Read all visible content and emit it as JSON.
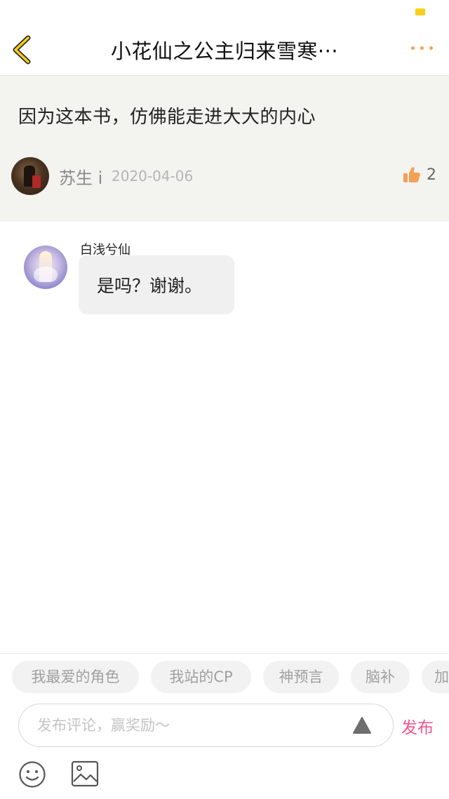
{
  "header": {
    "title": "小花仙之公主归来雪寒···"
  },
  "post": {
    "text": "因为这本书，仿佛能走进大大的内心",
    "author": "苏生 i",
    "date": "2020-04-06",
    "likes": "2"
  },
  "reply": {
    "username": "白浅兮仙",
    "text": "是吗？谢谢。"
  },
  "tags": [
    "我最爱的角色",
    "我站的CP",
    "神预言",
    "脑补",
    "加"
  ],
  "comment": {
    "placeholder": "发布评论，赢奖励～",
    "publish_label": "发布"
  },
  "colors": {
    "accent_orange": "#f3a056",
    "publish_pink": "#f0558c",
    "back_icon_yellow": "#f5cf1c",
    "card_bg": "#f3f3ef"
  },
  "icons": {
    "back": "chevron-left-icon",
    "more": "more-dots-icon",
    "like": "thumbs-up-icon",
    "expand": "triangle-up-icon",
    "emoji": "smiley-icon",
    "image": "image-icon"
  }
}
